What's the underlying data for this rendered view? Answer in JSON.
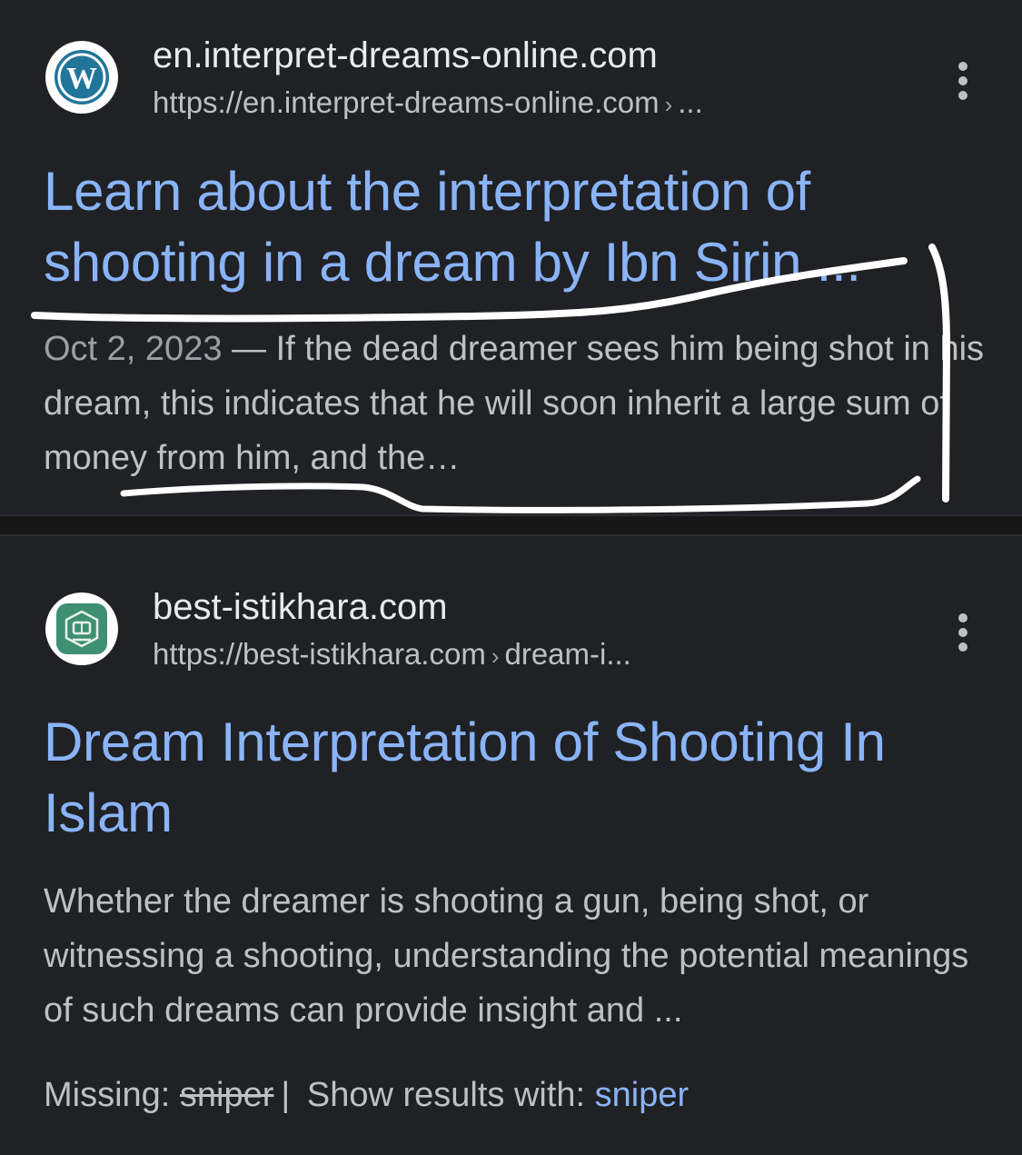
{
  "results": [
    {
      "site_name": "en.interpret-dreams-online.com",
      "url_base": "https://en.interpret-dreams-online.com",
      "url_chevron": "›",
      "url_tail": "...",
      "title": "Learn about the interpretation of shooting in a dream by Ibn Sirin ...",
      "date": "Oct 2, 2023",
      "snippet": " — If the dead dreamer sees him being shot in his dream, this indicates that he will soon inherit a large sum of money from him, and the…",
      "favicon_icon": "wordpress-logo-icon",
      "favicon_color": "#21759b"
    },
    {
      "site_name": "best-istikhara.com",
      "url_base": "https://best-istikhara.com",
      "url_chevron": "›",
      "url_tail": "dream-i...",
      "title": "Dream Interpretation of Shooting In Islam",
      "snippet": "Whether the dreamer is shooting a gun, being shot, or witnessing a shooting, understanding the potential meanings of such dreams can provide insight and ...",
      "favicon_icon": "istikhara-logo-icon",
      "favicon_color": "#3f8f72"
    }
  ],
  "missing_bar": {
    "missing_label": "Missing: ",
    "missing_term": "sniper",
    "divider": "|",
    "show_label": " Show results with: ",
    "show_term": "sniper"
  },
  "colors": {
    "background": "#202124",
    "title_link": "#8ab4f8",
    "snippet_text": "#bdc1c6",
    "annotation_ink": "#ffffff"
  }
}
